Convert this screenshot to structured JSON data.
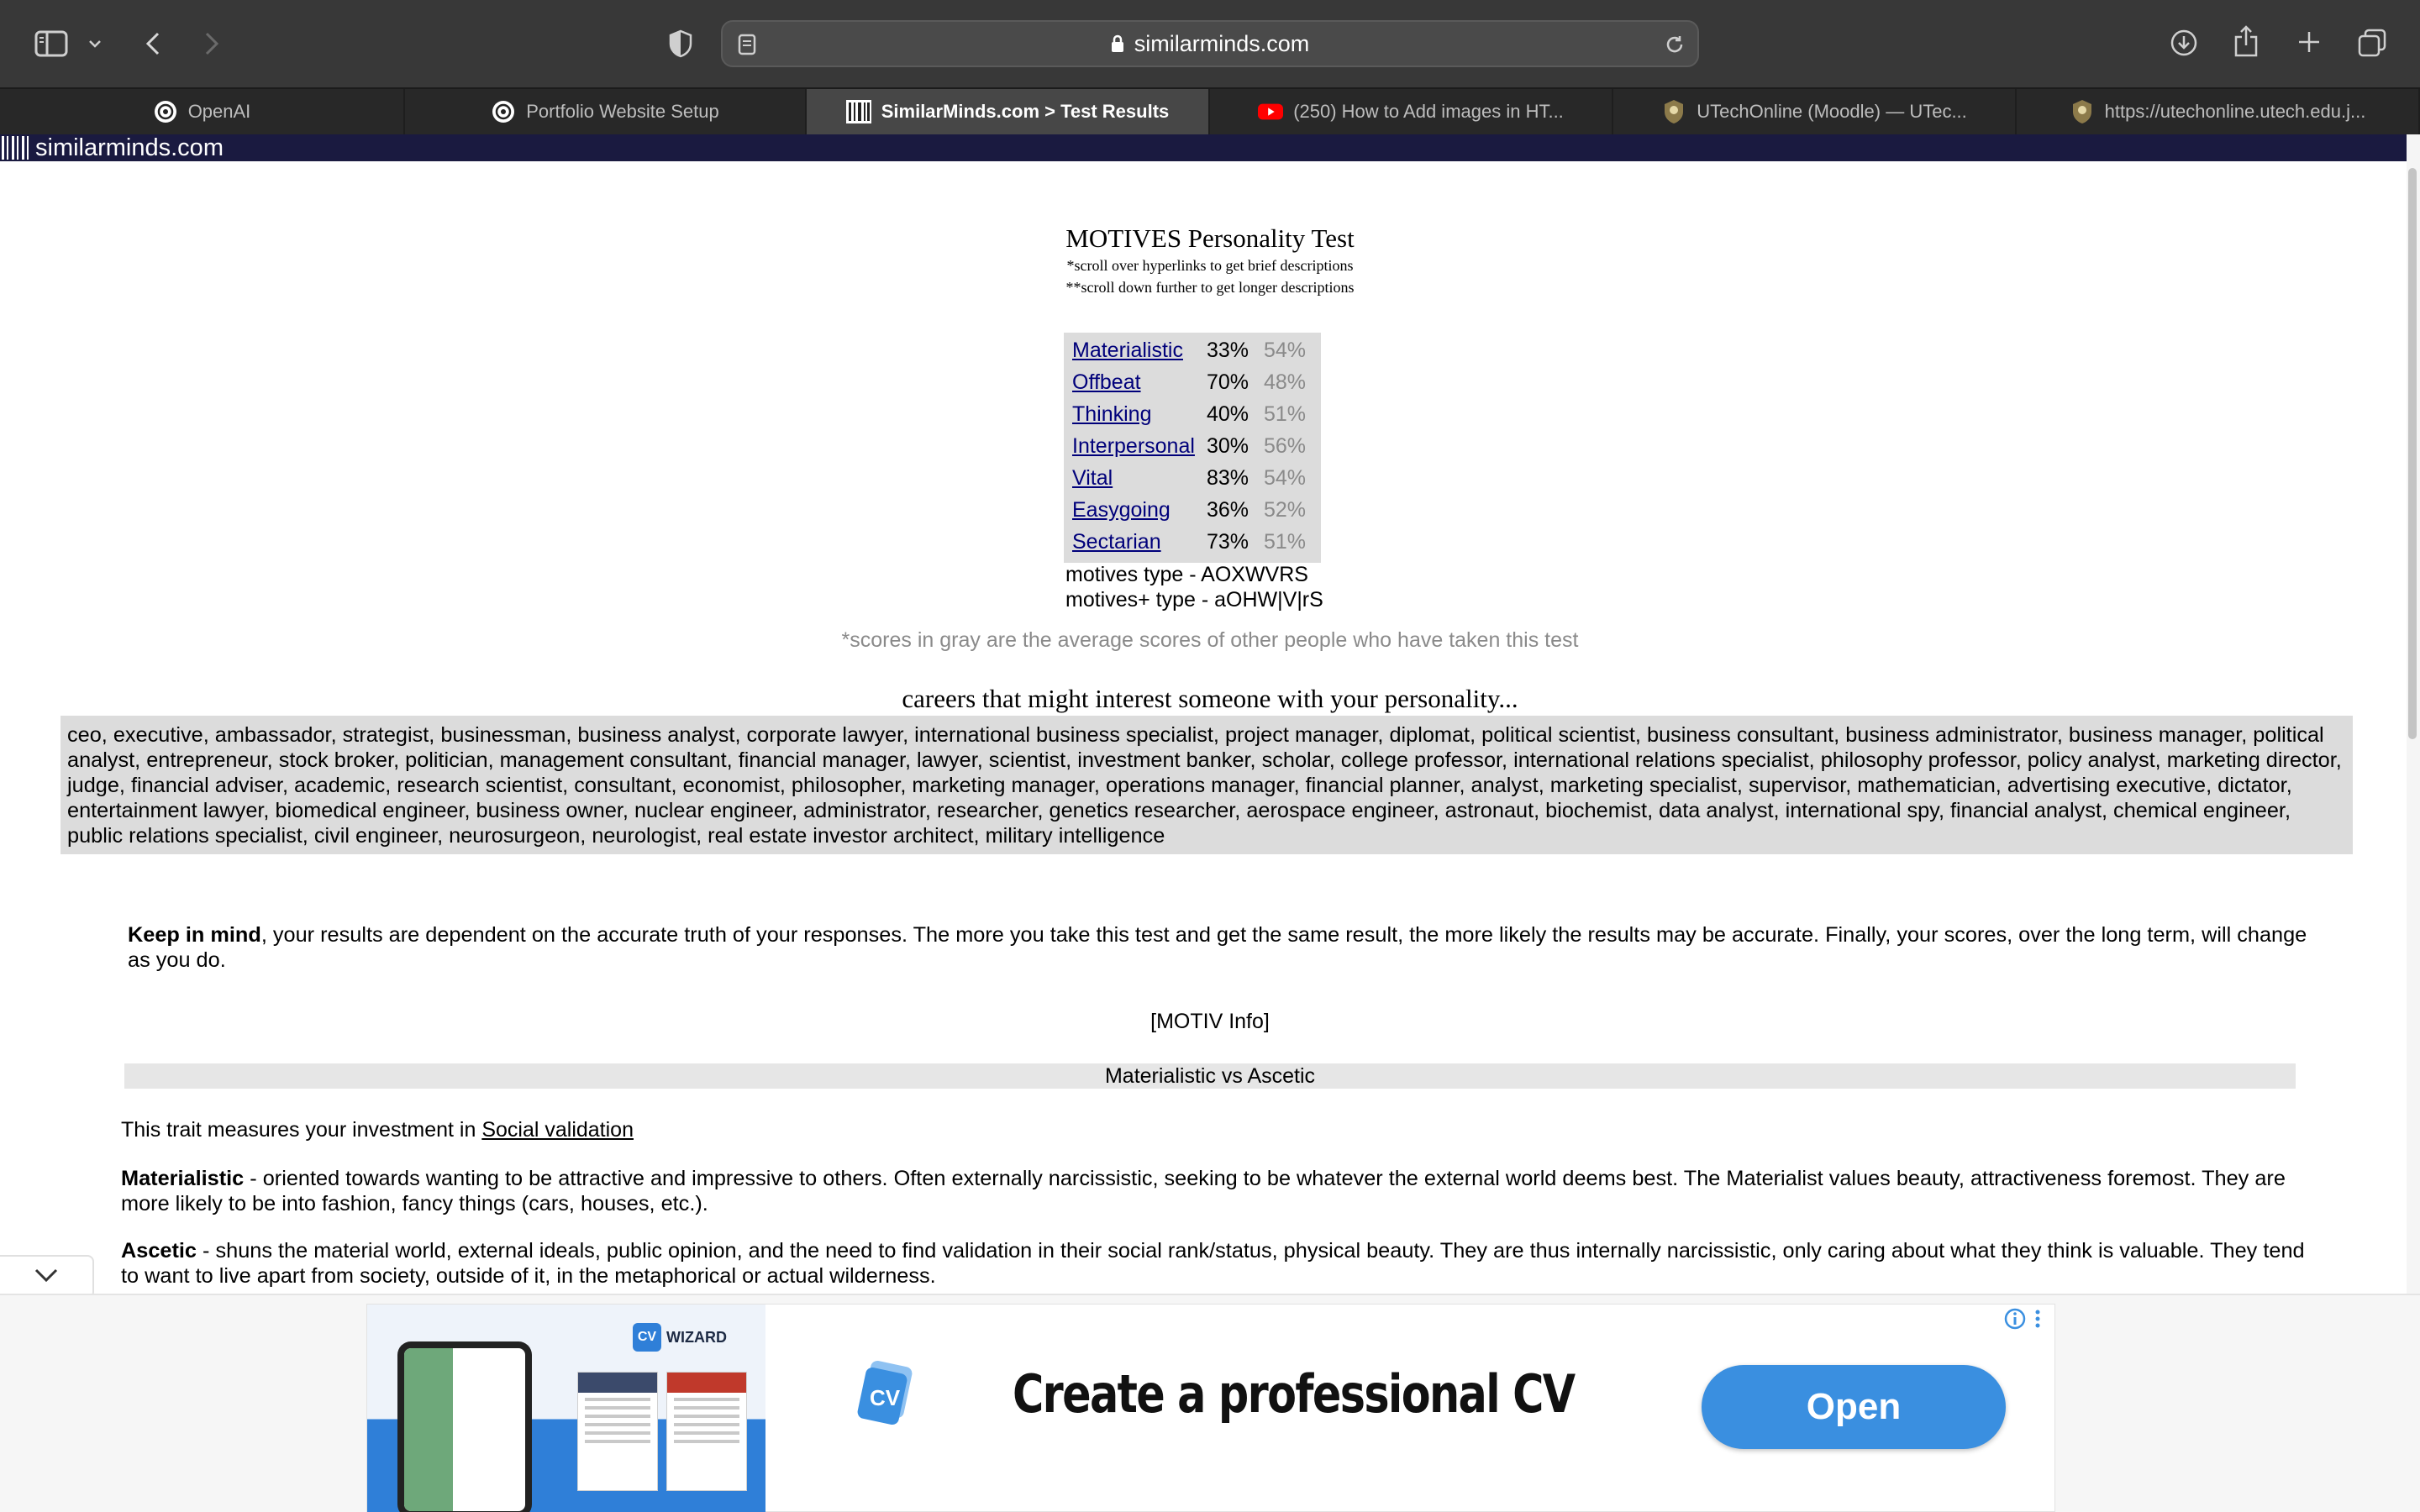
{
  "browser": {
    "url": "similarminds.com",
    "tabs": [
      {
        "title": "OpenAI",
        "icon": "openai-icon",
        "active": false
      },
      {
        "title": "Portfolio Website Setup",
        "icon": "openai-icon",
        "active": false
      },
      {
        "title": "SimilarMinds.com > Test Results",
        "icon": "similarminds-icon",
        "active": true
      },
      {
        "title": "(250) How to Add images in HT...",
        "icon": "youtube-icon",
        "active": false
      },
      {
        "title": "UTechOnline (Moodle) — UTec...",
        "icon": "utech-icon",
        "active": false
      },
      {
        "title": "https://utechonline.utech.edu.j...",
        "icon": "utech-icon",
        "active": false
      }
    ]
  },
  "site": {
    "name": "similarminds.com"
  },
  "test": {
    "title": "MOTIVES Personality Test",
    "note1": "*scroll over hyperlinks to get brief descriptions",
    "note2": "**scroll down further to get longer descriptions",
    "scores": [
      {
        "trait": "Materialistic",
        "you": "33%",
        "avg": "54%"
      },
      {
        "trait": "Offbeat",
        "you": "70%",
        "avg": "48%"
      },
      {
        "trait": "Thinking",
        "you": "40%",
        "avg": "51%"
      },
      {
        "trait": "Interpersonal",
        "you": "30%",
        "avg": "56%"
      },
      {
        "trait": "Vital",
        "you": "83%",
        "avg": "54%"
      },
      {
        "trait": "Easygoing",
        "you": "36%",
        "avg": "52%"
      },
      {
        "trait": "Sectarian",
        "you": "73%",
        "avg": "51%"
      }
    ],
    "motives_type": "motives type - AOXWVRS",
    "motives_plus_type": "motives+ type - aOHW|V|rS",
    "gray_note": "*scores in gray are the average scores of other people who have taken this test",
    "careers_heading": "careers that might interest someone with your personality...",
    "careers": "ceo, executive, ambassador, strategist, businessman, business analyst, corporate lawyer, international business specialist, project manager, diplomat, political scientist, business consultant, business administrator, business manager, political analyst, entrepreneur, stock broker, politician, management consultant, financial manager, lawyer, scientist, investment banker, scholar, college professor, international relations specialist, philosophy professor, policy analyst, marketing director, judge, financial adviser, academic, research scientist, consultant, economist, philosopher, marketing manager, operations manager, financial planner, analyst, marketing specialist, supervisor, mathematician, advertising executive, dictator, entertainment lawyer, biomedical engineer, business owner, nuclear engineer, administrator, researcher, genetics researcher, aerospace engineer, astronaut, biochemist, data analyst, international spy, financial analyst, chemical engineer, public relations specialist, civil engineer, neurosurgeon, neurologist, real estate investor architect, military intelligence",
    "keep_in_mind_bold": "Keep in mind",
    "keep_in_mind_text": ", your results are dependent on the accurate truth of your responses. The more you take this test and get the same result, the more likely the results may be accurate. Finally, your scores, over the long term, will change as you do.",
    "motiv_info": "[MOTIV Info]",
    "section_title": "Materialistic vs Ascetic",
    "measure_prefix": "This trait measures your investment in ",
    "measure_link": "Social validation",
    "materialistic_bold": "Materialistic",
    "materialistic_text": " - oriented towards wanting to be attractive and impressive to others. Often externally narcissistic, seeking to be whatever the external world deems best. The Materialist values beauty, attractiveness foremost. They are more likely to be into fashion, fancy things (cars, houses, etc.).",
    "ascetic_bold": "Ascetic",
    "ascetic_text": " - shuns the material world, external ideals, public opinion, and the need to find validation in their social rank/status, physical beauty. They are thus internally narcissistic, only caring about what they think is valuable. They tend to want to live apart from society, outside of it, in the metaphorical or actual wilderness."
  },
  "ad": {
    "brand": "WIZARD",
    "brand_badge": "CV",
    "headline": "Create a professional CV",
    "button": "Open",
    "info_icon": "info-icon",
    "more_icon": "more-vertical-icon",
    "button_color": "#3a8fe0"
  }
}
